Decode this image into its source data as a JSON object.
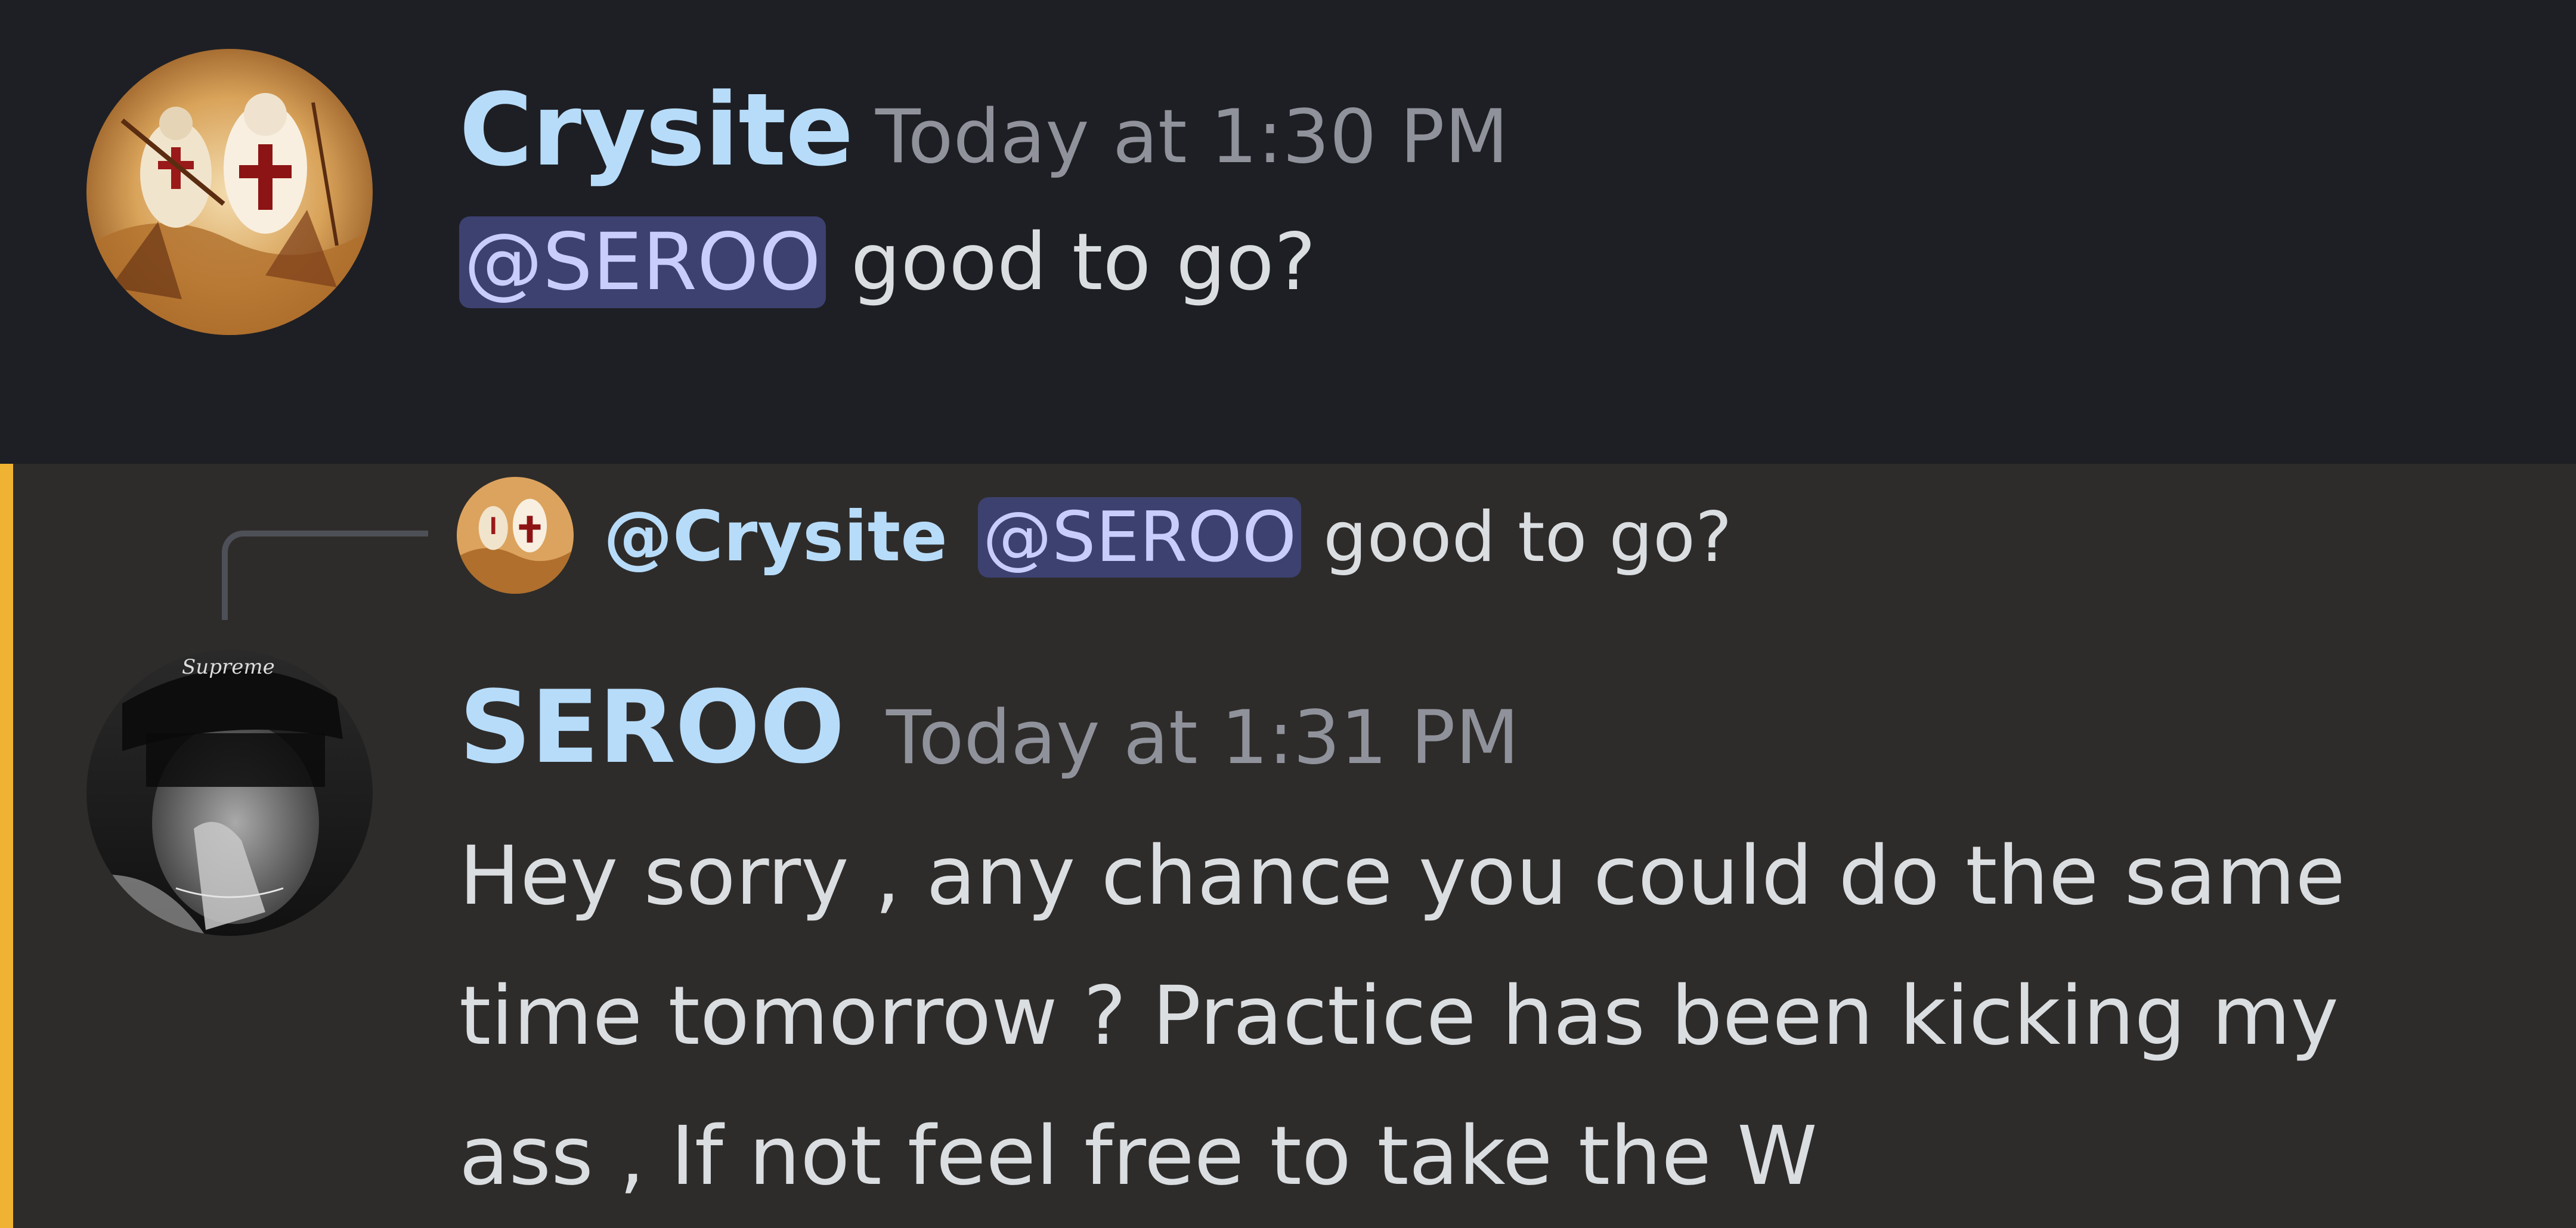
{
  "message1": {
    "author": "Crysite",
    "timestamp": "Today at 1:30 PM",
    "mention": "@SEROO",
    "text": "good to go?"
  },
  "message2": {
    "reply": {
      "author": "@Crysite",
      "mention": "@SEROO",
      "text": "good to go?"
    },
    "author": "SEROO",
    "timestamp": "Today at 1:31 PM",
    "lines": [
      "Hey sorry , any chance you could do the same",
      "time  tomorrow ? Practice has been kicking my",
      "ass , If not feel free to take the W"
    ],
    "avatar_cap_text": "Supreme"
  },
  "colors": {
    "background_dark": "#1e1f24",
    "background_highlight": "#2e2c2a",
    "highlight_bar": "#f0b232",
    "username": "#b7dcfa",
    "mention_bg": "#3c4170",
    "mention_text": "#c9cdfb",
    "text": "#dbdee1",
    "timestamp": "#90929b"
  },
  "icons": {
    "avatar1": "crusader-painting-avatar",
    "avatar2": "person-portrait-avatar"
  }
}
